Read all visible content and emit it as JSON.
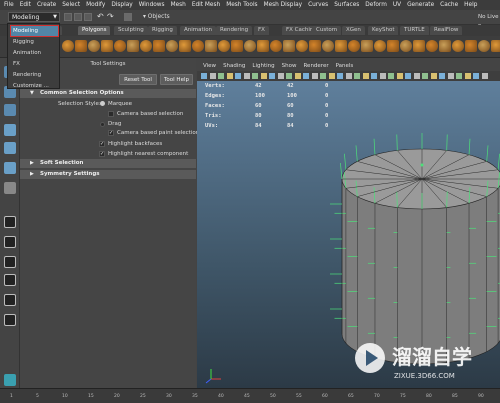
{
  "menubar": [
    "File",
    "Edit",
    "Create",
    "Select",
    "Modify",
    "Display",
    "Windows",
    "Mesh",
    "Edit Mesh",
    "Mesh Tools",
    "Mesh Display",
    "Curves",
    "Surfaces",
    "Deform",
    "UV",
    "Generate",
    "Cache",
    "Help"
  ],
  "statusline": {
    "mode": "Modeling",
    "objects_label": "Objects",
    "no_live": "No Live Su"
  },
  "shelf_tabs": [
    "ces",
    "Polygons",
    "Sculpting",
    "Rigging",
    "Animation",
    "Rendering",
    "FX",
    "FX Caching",
    "Custom",
    "XGen",
    "KeyShot",
    "TURTLE",
    "RealFlow"
  ],
  "shelf_active": "Polygons",
  "dropdown": {
    "items": [
      "Modeling",
      "Rigging",
      "Animation",
      "FX",
      "Rendering",
      "Customize ..."
    ],
    "selected": "Modeling"
  },
  "tool_settings": {
    "title": "Tool Settings",
    "reset_button": "Reset Tool",
    "help_button": "Tool Help",
    "sections": {
      "common": "Common Selection Options",
      "soft": "Soft Selection",
      "symmetry": "Symmetry Settings"
    },
    "selection_style_label": "Selection Style:",
    "marquee": "Marquee",
    "camera_based_selection": "Camera based selection",
    "drag": "Drag",
    "camera_based_paint": "Camera based paint selection",
    "highlight_backfaces": "Highlight backfaces",
    "highlight_nearest": "Highlight nearest component"
  },
  "viewport": {
    "menu": [
      "View",
      "Shading",
      "Lighting",
      "Show",
      "Renderer",
      "Panels"
    ],
    "hud": [
      {
        "label": "Verts:",
        "a": "42",
        "b": "42",
        "c": "0"
      },
      {
        "label": "Edges:",
        "a": "100",
        "b": "100",
        "c": "0"
      },
      {
        "label": "Faces:",
        "a": "60",
        "b": "60",
        "c": "0"
      },
      {
        "label": "Tris:",
        "a": "80",
        "b": "80",
        "c": "0"
      },
      {
        "label": "UVs:",
        "a": "84",
        "b": "84",
        "c": "0"
      }
    ]
  },
  "timeline": {
    "ticks": [
      "1",
      "5",
      "10",
      "15",
      "20",
      "25",
      "30",
      "35",
      "40",
      "45",
      "50",
      "55",
      "60",
      "65",
      "70",
      "75",
      "80",
      "85",
      "90"
    ]
  },
  "watermark": {
    "text": "溜溜自学",
    "url": "ZIXUE.3D66.COM"
  },
  "colors": {
    "accent": "#5285a6",
    "highlight_red": "#d03030",
    "wire_green": "#4de07a"
  }
}
